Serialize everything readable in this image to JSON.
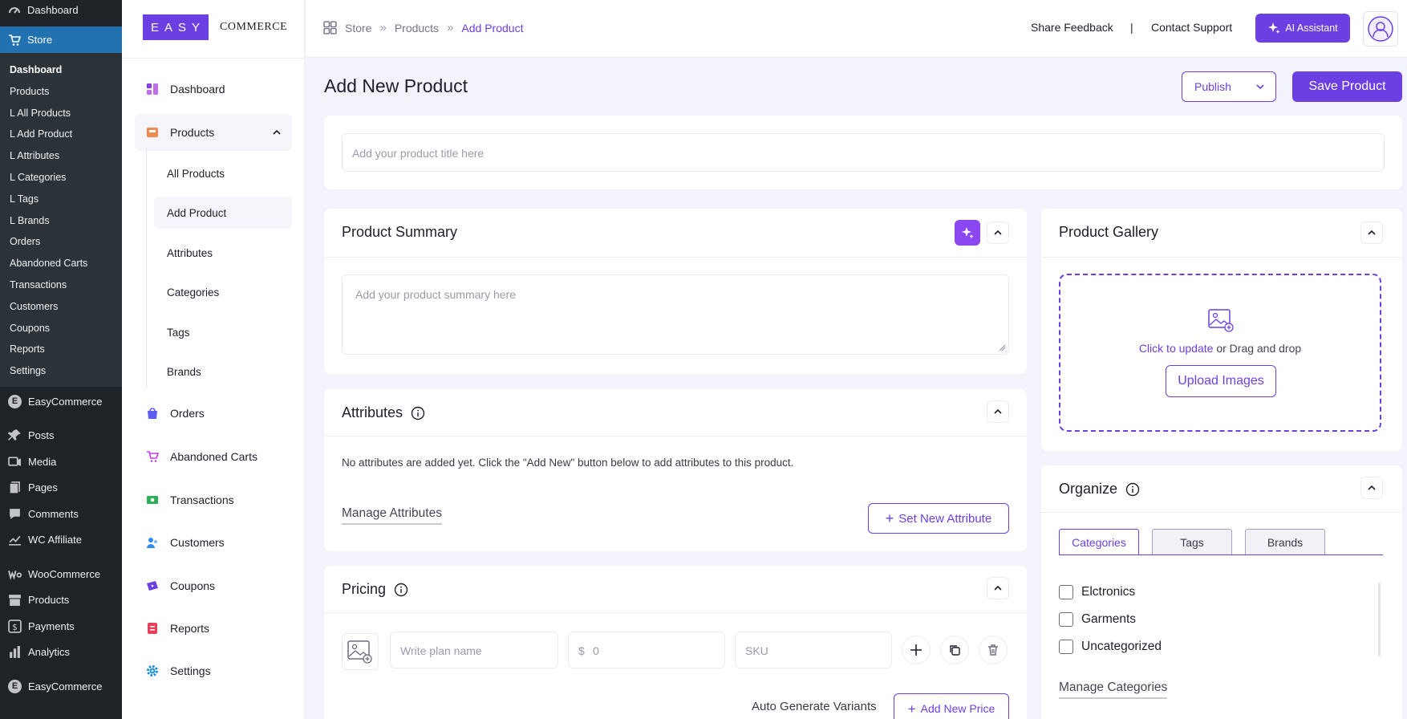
{
  "wp_admin": {
    "dashboard": "Dashboard",
    "store": "Store",
    "store_sub": [
      "Dashboard",
      "Products",
      "L All Products",
      "L Add Product",
      "L Attributes",
      "L Categories",
      "L Tags",
      "L Brands",
      "Orders",
      "Abandoned Carts",
      "Transactions",
      "Customers",
      "Coupons",
      "Reports",
      "Settings"
    ],
    "easycommerce": "EasyCommerce",
    "posts": "Posts",
    "media": "Media",
    "pages": "Pages",
    "comments": "Comments",
    "wc_affiliate": "WC Affiliate",
    "woocommerce": "WooCommerce",
    "products": "Products",
    "payments": "Payments",
    "analytics": "Analytics",
    "easycommerce_bottom": "EasyCommerce",
    "e_badge": "E"
  },
  "brand": {
    "logo_text": "EASY",
    "logo_word": "COMMERCE"
  },
  "sidebar": {
    "dashboard": "Dashboard",
    "products": "Products",
    "product_sub": [
      "All Products",
      "Add Product",
      "Attributes",
      "Categories",
      "Tags",
      "Brands"
    ],
    "orders": "Orders",
    "abandoned_carts": "Abandoned Carts",
    "transactions": "Transactions",
    "customers": "Customers",
    "coupons": "Coupons",
    "reports": "Reports",
    "settings": "Settings"
  },
  "header": {
    "breadcrumb": [
      "Store",
      "Products",
      "Add Product"
    ],
    "share_feedback": "Share Feedback",
    "separator": "|",
    "contact_support": "Contact Support",
    "ai_assistant": "AI Assistant"
  },
  "page": {
    "title": "Add New Product",
    "publish": "Publish",
    "save": "Save Product",
    "title_placeholder": "Add your product title here"
  },
  "summary": {
    "heading": "Product Summary",
    "placeholder": "Add your product summary here"
  },
  "attributes": {
    "heading": "Attributes",
    "empty_text": "No attributes are added yet. Click the \"Add New\" button below to add attributes to this product.",
    "manage": "Manage Attributes",
    "set_new": "Set New Attribute"
  },
  "pricing": {
    "heading": "Pricing",
    "plan_placeholder": "Write plan name",
    "currency": "$",
    "price_placeholder": "0",
    "sku_placeholder": "SKU",
    "auto_generate": "Auto Generate Variants",
    "add_price": "Add New Price"
  },
  "gallery": {
    "heading": "Product Gallery",
    "click_update": "Click to update",
    "drag_drop": "or Drag and drop",
    "upload": "Upload Images"
  },
  "organize": {
    "heading": "Organize",
    "tabs": [
      "Categories",
      "Tags",
      "Brands"
    ],
    "categories": [
      "Elctronics",
      "Garments",
      "Uncategorized"
    ],
    "manage": "Manage Categories"
  },
  "colors": {
    "accent": "#6c3fe3",
    "wp_dark": "#1d2327",
    "wp_blue": "#2271b1"
  }
}
